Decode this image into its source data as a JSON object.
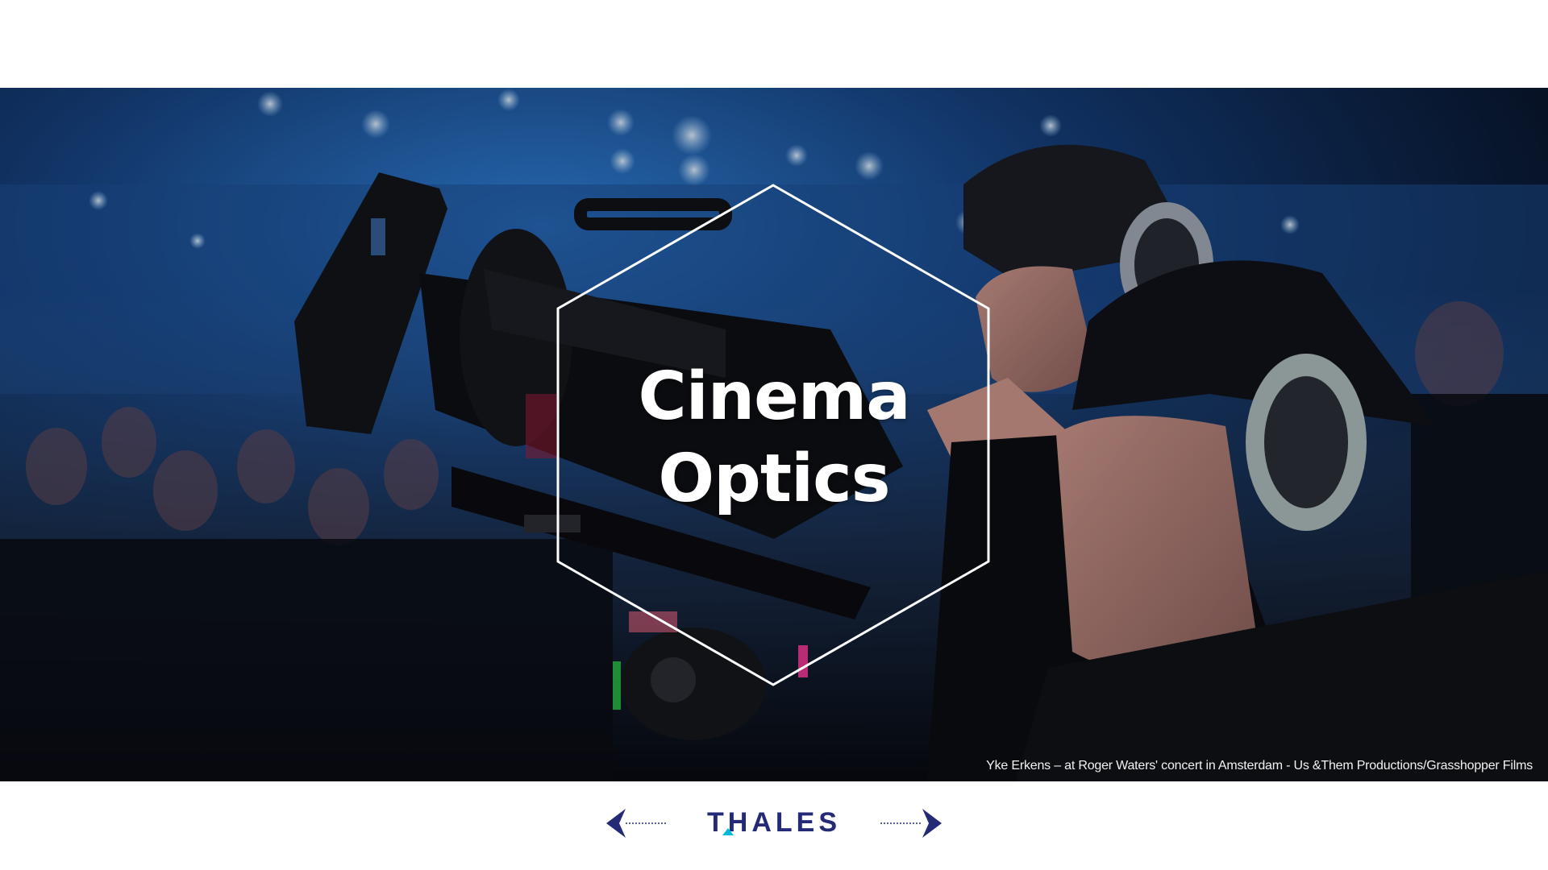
{
  "slide": {
    "title_line1": "Cinema",
    "title_line2": "Optics",
    "photo_caption": "Yke Erkens – at Roger Waters' concert in Amsterdam - Us &Them Productions/Grasshopper Films",
    "logo_text": "THALES"
  },
  "icons": {
    "previous": "arrow-left-icon",
    "next": "arrow-right-icon",
    "frame": "hexagon-outline"
  },
  "colors": {
    "logo": "#242a75",
    "logo_accent": "#00bbdd",
    "title": "#ffffff",
    "background": "#ffffff"
  }
}
